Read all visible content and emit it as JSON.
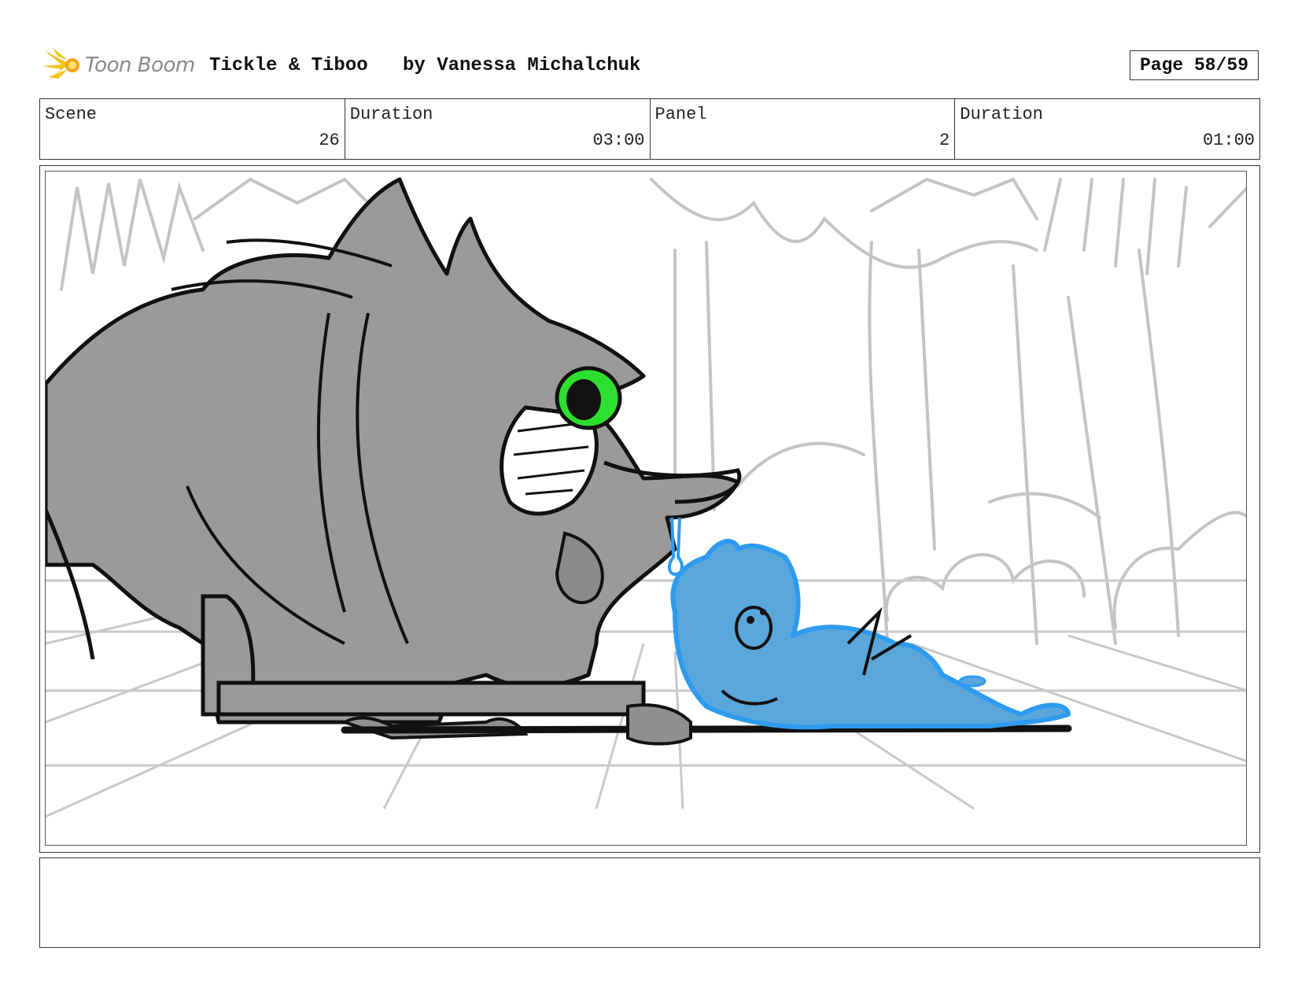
{
  "header": {
    "logo_text": "Toon Boom",
    "title": "Tickle & Tiboo",
    "author": "by Vanessa Michalchuk",
    "page": "Page 58/59"
  },
  "info": {
    "scene_label": "Scene",
    "scene_value": "26",
    "scene_duration_label": "Duration",
    "scene_duration_value": "03:00",
    "panel_label": "Panel",
    "panel_value": "2",
    "panel_duration_label": "Duration",
    "panel_duration_value": "01:00"
  },
  "panel": {
    "image_name": "storyboard-sketch",
    "colors": {
      "beast_fill": "#9a9a9a",
      "eye": "#2ee02e",
      "character_fill": "#5aa7db",
      "character_line": "#2e9bf0",
      "background_lines": "#c4c4c4"
    }
  },
  "dialog": {
    "text": ""
  }
}
